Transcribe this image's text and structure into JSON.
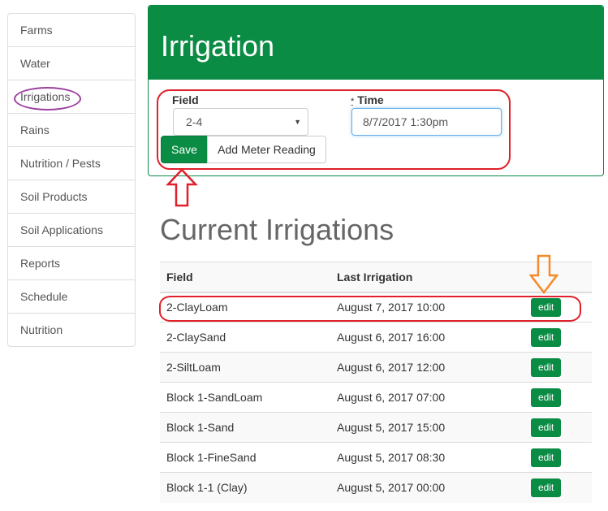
{
  "sidebar": {
    "items": [
      {
        "label": "Farms"
      },
      {
        "label": "Water"
      },
      {
        "label": "Irrigations"
      },
      {
        "label": "Rains"
      },
      {
        "label": "Nutrition / Pests"
      },
      {
        "label": "Soil Products"
      },
      {
        "label": "Soil Applications"
      },
      {
        "label": "Reports"
      },
      {
        "label": "Schedule"
      },
      {
        "label": "Nutrition"
      }
    ]
  },
  "panel": {
    "title": "Irrigation",
    "field_label": "Field",
    "field_value": "2-4",
    "time_required_mark": "*",
    "time_label": "Time",
    "time_value": "8/7/2017 1:30pm",
    "save_label": "Save",
    "meter_label": "Add Meter Reading"
  },
  "current": {
    "title": "Current Irrigations",
    "headers": {
      "field": "Field",
      "last": "Last Irrigation"
    },
    "edit_label": "edit",
    "rows": [
      {
        "field": "2-ClayLoam",
        "last": "August 7, 2017 10:00"
      },
      {
        "field": "2-ClaySand",
        "last": "August 6, 2017 16:00"
      },
      {
        "field": "2-SiltLoam",
        "last": "August 6, 2017 12:00"
      },
      {
        "field": "Block 1-SandLoam",
        "last": "August 6, 2017 07:00"
      },
      {
        "field": "Block 1-Sand",
        "last": "August 5, 2017 15:00"
      },
      {
        "field": "Block 1-FineSand",
        "last": "August 5, 2017 08:30"
      },
      {
        "field": "Block 1-1 (Clay)",
        "last": "August 5, 2017 00:00"
      }
    ]
  },
  "colors": {
    "brand_green": "#0b8c45",
    "annotation_red": "#e0202a",
    "annotation_purple": "#9b3fa0",
    "annotation_orange": "#f58a2a"
  }
}
